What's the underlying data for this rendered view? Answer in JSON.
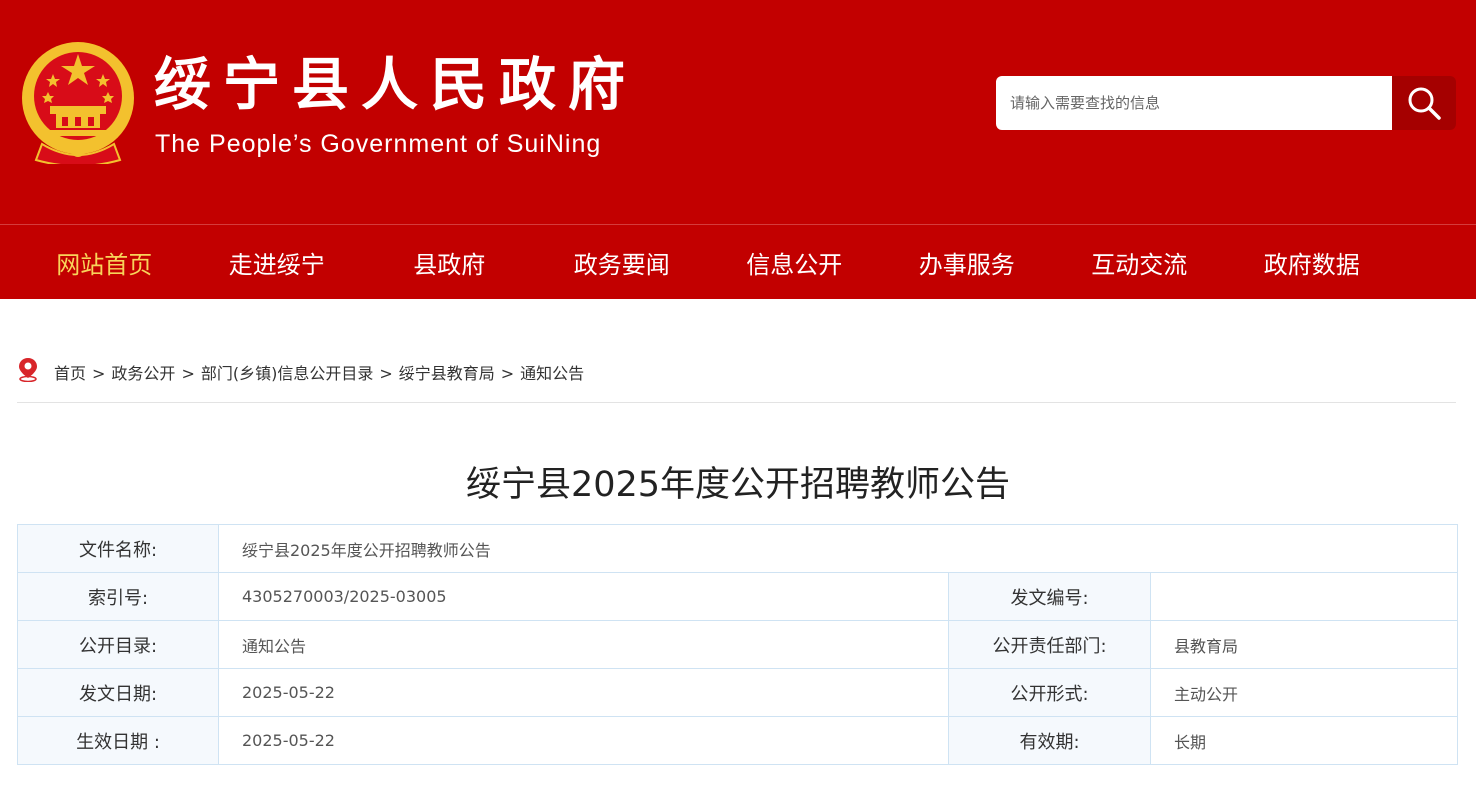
{
  "header": {
    "title": "绥宁县人民政府",
    "subtitle": "The People’s Government of SuiNing",
    "search_placeholder": "请输入需要查找的信息"
  },
  "nav": [
    {
      "label": "网站首页",
      "active": true
    },
    {
      "label": "走进绥宁"
    },
    {
      "label": "县政府"
    },
    {
      "label": "政务要闻"
    },
    {
      "label": "信息公开"
    },
    {
      "label": "办事服务"
    },
    {
      "label": "互动交流"
    },
    {
      "label": "政府数据"
    }
  ],
  "breadcrumb": [
    "首页",
    "政务公开",
    "部门(乡镇)信息公开目录",
    "绥宁县教育局",
    "通知公告"
  ],
  "breadcrumb_separator": ">",
  "doc_title": "绥宁县2025年度公开招聘教师公告",
  "meta": {
    "file_name_label": "文件名称:",
    "file_name": "绥宁县2025年度公开招聘教师公告",
    "index_label": "索引号:",
    "index": "4305270003/2025-03005",
    "doc_no_label": "发文编号:",
    "doc_no": "",
    "catalog_label": "公开目录:",
    "catalog": "通知公告",
    "dept_label": "公开责任部门:",
    "dept": "县教育局",
    "issue_date_label": "发文日期:",
    "issue_date": "2025-05-22",
    "form_label": "公开形式:",
    "form": "主动公开",
    "effective_date_label": "生效日期 :",
    "effective_date": "2025-05-22",
    "validity_label": "有效期:",
    "validity": "长期"
  },
  "colors": {
    "brand_red": "#c20000",
    "nav_active": "#f8d35a",
    "emblem_gold": "#f3c12e"
  },
  "icons": [
    "national-emblem",
    "search-icon",
    "location-pin-icon"
  ]
}
